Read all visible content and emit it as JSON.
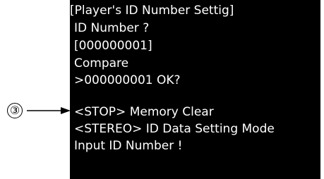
{
  "callout": {
    "number": "③"
  },
  "screen": {
    "lines": [
      "[Player's ID Number Settig]",
      "ID Number ?",
      "[000000001]",
      "Compare",
      ">000000001 OK?",
      "",
      "<STOP> Memory Clear",
      "<STEREO> ID Data Setting Mode",
      "Input ID Number !"
    ]
  },
  "colors": {
    "screen_background": "#000000",
    "screen_text": "#ffffff",
    "page_background": "#ffffff"
  }
}
